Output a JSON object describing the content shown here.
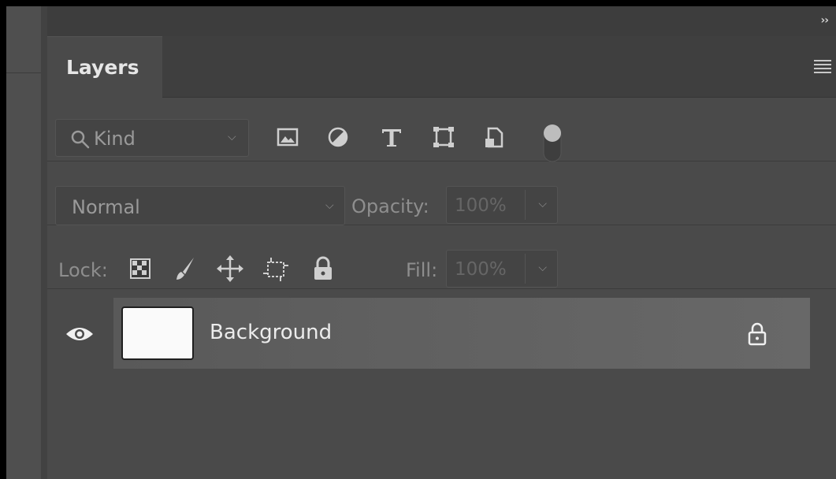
{
  "panel": {
    "tab_label": "Layers",
    "expand_glyph": "››",
    "menu_icon": "hamburger-menu-icon"
  },
  "filter": {
    "kind_label": "Kind",
    "icons": [
      "image-filter-icon",
      "adjustment-filter-icon",
      "type-filter-icon",
      "shape-filter-icon",
      "smart-object-filter-icon"
    ],
    "toggle": "filter-toggle-switch"
  },
  "blend": {
    "mode": "Normal",
    "opacity_label": "Opacity:",
    "opacity_value": "100%"
  },
  "lock": {
    "label": "Lock:",
    "icons": [
      "lock-transparent-pixels-icon",
      "lock-image-pixels-icon",
      "lock-position-icon",
      "lock-artboard-icon",
      "lock-all-icon"
    ],
    "fill_label": "Fill:",
    "fill_value": "100%"
  },
  "layers": [
    {
      "name": "Background",
      "visible": true,
      "locked": true,
      "thumbnail_color": "#fafafa"
    }
  ],
  "colors": {
    "panel_bg": "#4a4a4a",
    "tab_bar_bg": "#3f3f3f",
    "selected_layer_bg": "#626262",
    "text_bright": "#ececec",
    "text_dim": "#8e8e8e"
  }
}
